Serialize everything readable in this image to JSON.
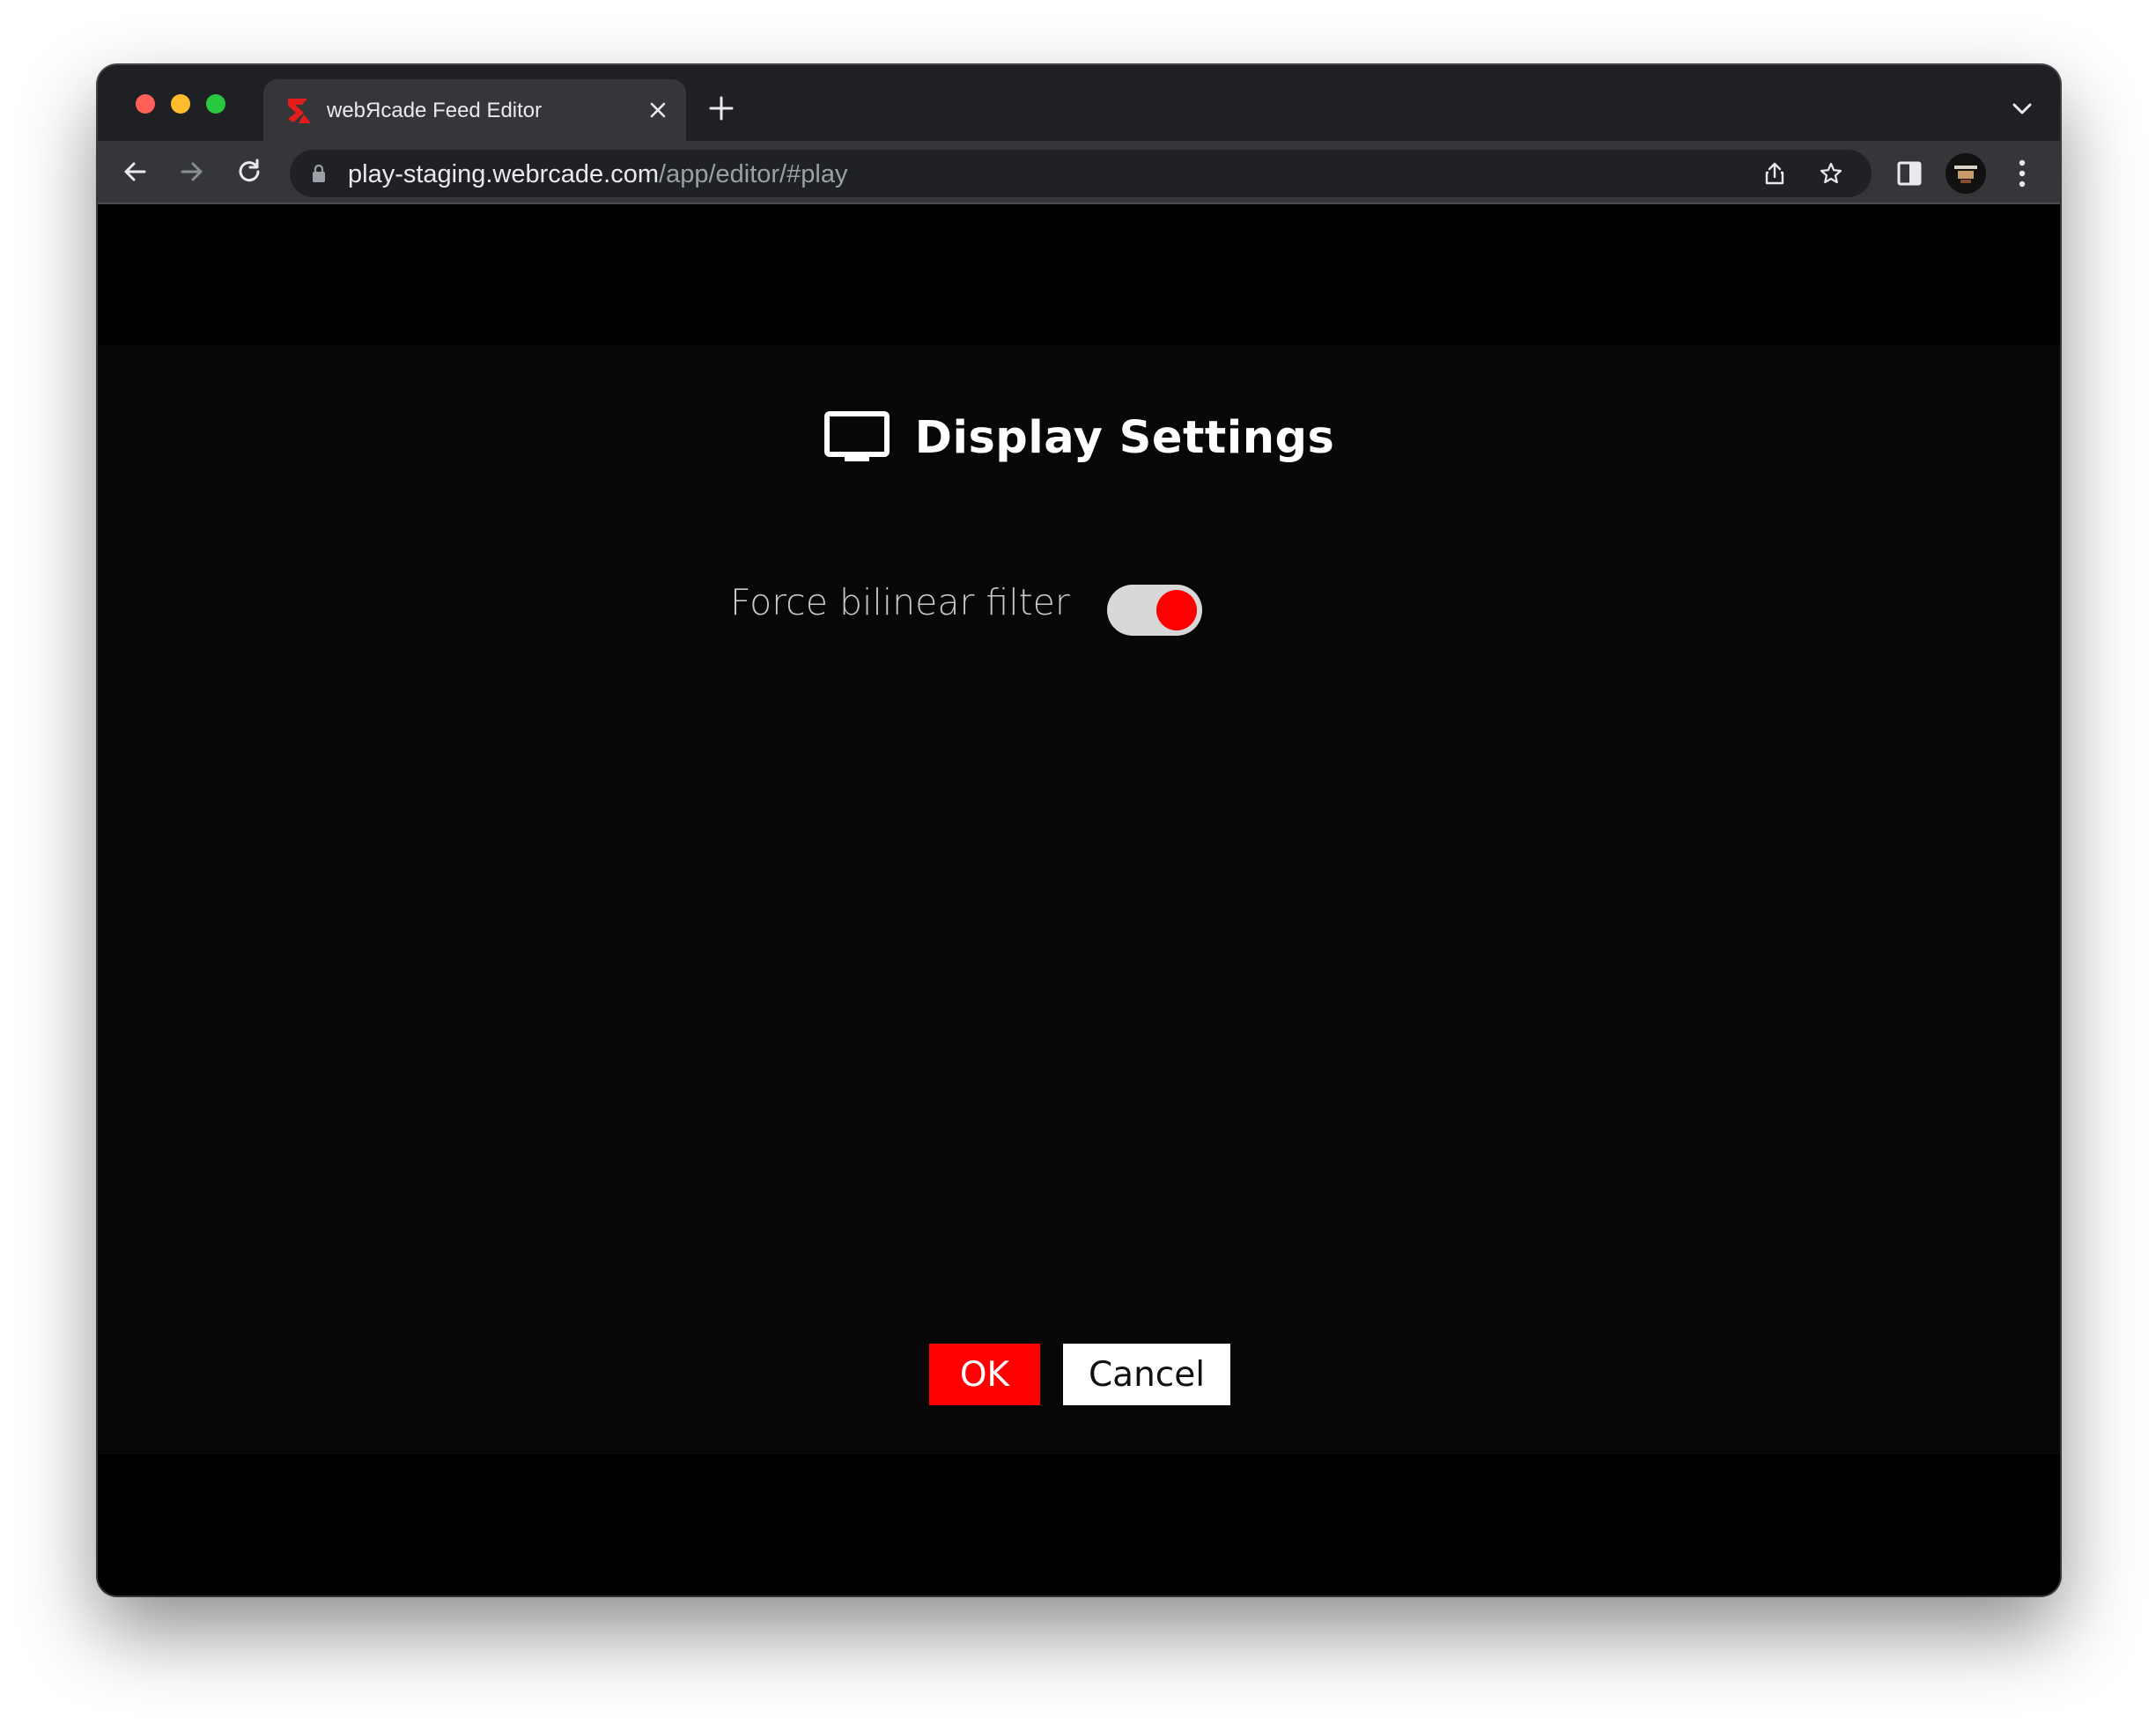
{
  "browser": {
    "tab": {
      "title": "webЯcade Feed Editor"
    },
    "address_bar": {
      "host": "play-staging.webrcade.com",
      "path": "/app/editor/#play"
    },
    "icons": {
      "back": "arrow-left-icon",
      "forward": "arrow-right-icon",
      "reload": "reload-icon",
      "lock": "lock-icon",
      "share": "share-icon",
      "bookmark": "star-icon",
      "side_panel": "side-panel-icon",
      "menu": "kebab-menu-icon"
    }
  },
  "dialog": {
    "title": "Display Settings",
    "title_icon": "monitor-icon",
    "settings": [
      {
        "label": "Force bilinear filter",
        "enabled": true
      }
    ],
    "buttons": {
      "ok": "OK",
      "cancel": "Cancel"
    }
  },
  "colors": {
    "accent": "#ff0000",
    "dialog_background": "#070707",
    "page_background": "#000000",
    "toggle_track": "#d8d8d8"
  }
}
